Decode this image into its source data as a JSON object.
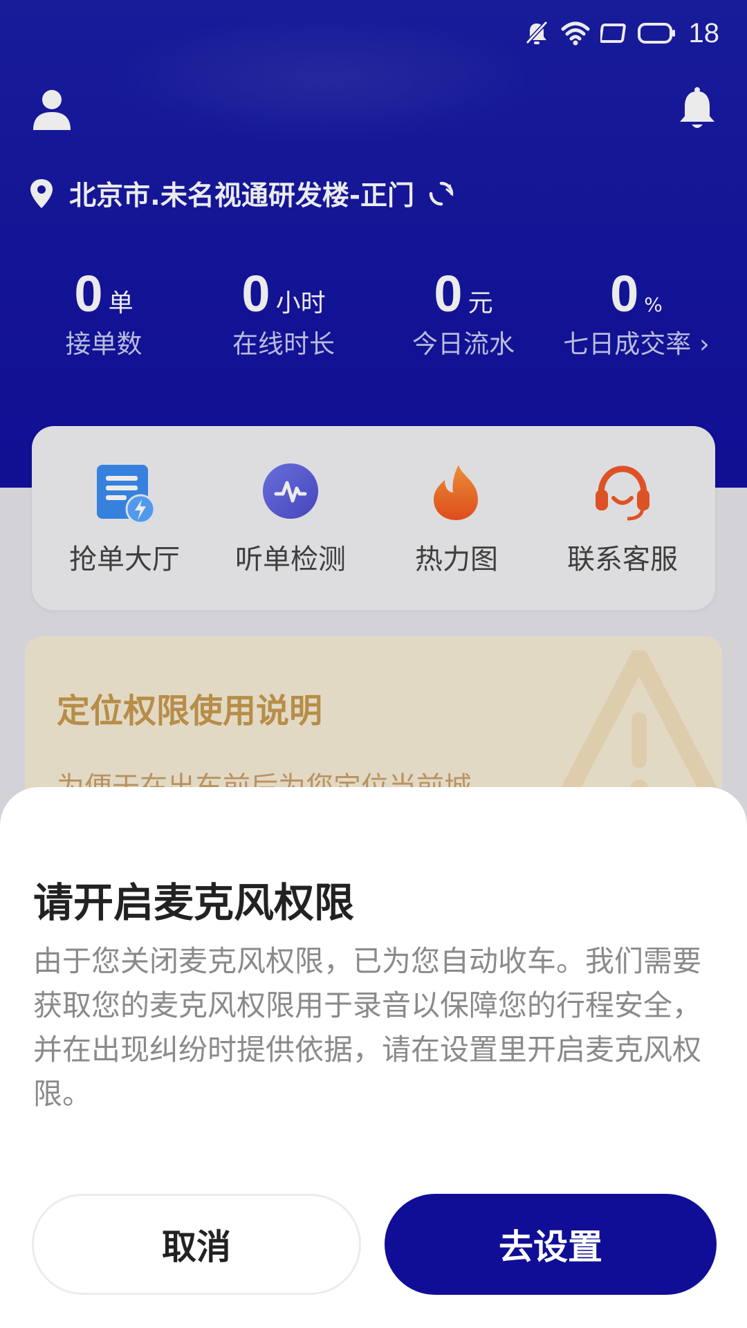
{
  "status_bar": {
    "time": "18",
    "icons": [
      "mute-icon",
      "wifi-icon",
      "screen-icon",
      "battery-icon"
    ]
  },
  "header": {
    "location": "北京市.未名视通研发楼-正门",
    "icons": [
      "user-icon",
      "bell-icon",
      "location-pin-icon",
      "refresh-icon"
    ]
  },
  "stats": [
    {
      "value": "0",
      "unit": "单",
      "label": "接单数"
    },
    {
      "value": "0",
      "unit": "小时",
      "label": "在线时长"
    },
    {
      "value": "0",
      "unit": "元",
      "label": "今日流水"
    },
    {
      "value": "0",
      "unit": "%",
      "label": "七日成交率"
    }
  ],
  "stats_arrow": "›",
  "quick_actions": [
    {
      "label": "抢单大厅",
      "icon": "order-hall-icon"
    },
    {
      "label": "听单检测",
      "icon": "listen-check-icon"
    },
    {
      "label": "热力图",
      "icon": "heatmap-flame-icon"
    },
    {
      "label": "联系客服",
      "icon": "customer-service-icon"
    }
  ],
  "notice": {
    "title": "定位权限使用说明",
    "text": "为便于在出车前后为您定位当前城"
  },
  "dialog": {
    "title": "请开启麦克风权限",
    "body": "由于您关闭麦克风权限，已为您自动收车。我们需要获取您的麦克风权限用于录音以保障您的行程安全，并在出现纠纷时提供依据，请在设置里开启麦克风权限。",
    "cancel_label": "取消",
    "confirm_label": "去设置"
  },
  "colors": {
    "brand": "#1311a0",
    "notice_bg": "#f6ecd6",
    "notice_title": "#c79a4e",
    "confirm_button": "#100e96"
  }
}
